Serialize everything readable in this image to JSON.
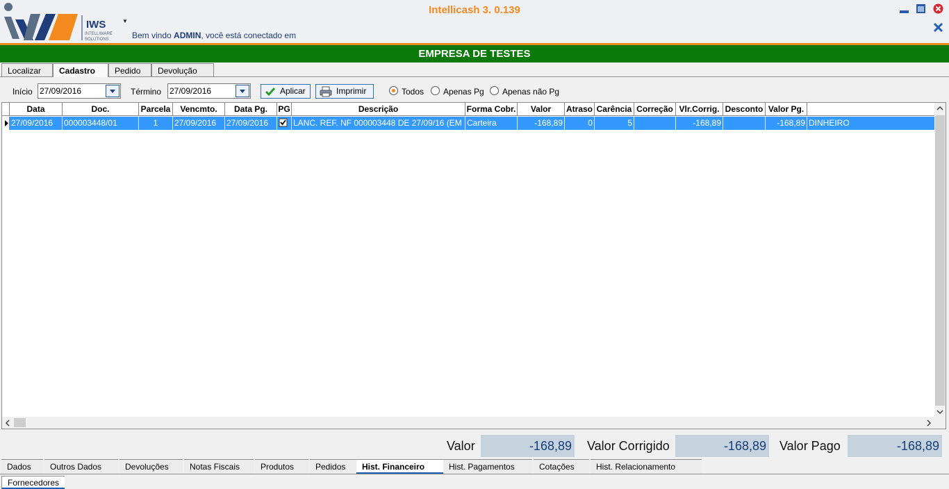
{
  "window": {
    "title": "Intellicash 3. 0.139"
  },
  "header": {
    "logo_text": "IWS",
    "logo_sub1": "INTELLIWARE",
    "logo_sub2": "SOLUTIONS",
    "welcome_prefix": "Bem vindo ",
    "welcome_user": "ADMIN",
    "welcome_suffix": ", você está conectado em"
  },
  "company": {
    "name": "EMPRESA DE TESTES"
  },
  "top_tabs": [
    "Localizar",
    "Cadastro",
    "Pedido",
    "Devolução"
  ],
  "filter": {
    "inicio_label": "Início",
    "inicio_value": "27/09/2016",
    "termino_label": "Término",
    "termino_value": "27/09/2016",
    "apply_label": "Aplicar",
    "print_label": "Imprimir",
    "radio_todos": "Todos",
    "radio_pg": "Apenas Pg",
    "radio_nao_pg": "Apenas não Pg",
    "selected": "Todos"
  },
  "grid": {
    "columns": [
      "Data",
      "Doc.",
      "Parcela",
      "Vencmto.",
      "Data Pg.",
      "PG",
      "Descrição",
      "Forma Cobr.",
      "Valor",
      "Atraso",
      "Carência",
      "Correção",
      "Vlr.Corrig.",
      "Desconto",
      "Valor Pg."
    ],
    "rows": [
      {
        "data": "27/09/2016",
        "doc": "000003448/01",
        "parcela": "1",
        "vencmto": "27/09/2016",
        "data_pg": "27/09/2016",
        "pg": true,
        "descricao": "LANC. REF. NF 000003448 DE 27/09/16 (EM",
        "forma_cobr": "Carteira",
        "valor": "-168,89",
        "atraso": "0",
        "carencia": "5",
        "correcao": "",
        "vlr_corrig": "-168,89",
        "desconto": "",
        "valor_pg": "-168,89",
        "extra": "DINHEIRO"
      }
    ]
  },
  "totals": {
    "valor_label": "Valor",
    "valor": "-168,89",
    "corrigido_label": "Valor Corrigido",
    "corrigido": "-168,89",
    "pago_label": "Valor Pago",
    "pago": "-168,89"
  },
  "bottom_tabs": [
    "Dados",
    "Outros Dados",
    "Devoluções",
    "Notas Fiscais",
    "Produtos",
    "Pedidos",
    "Hist. Financeiro",
    "Hist. Pagamentos",
    "Cotações",
    "Hist. Relacionamento"
  ],
  "footer_tab": "Fornecedores",
  "colors": {
    "company_bar": "#0b7a0b",
    "title": "#f28a20",
    "selection": "#3399ff"
  }
}
